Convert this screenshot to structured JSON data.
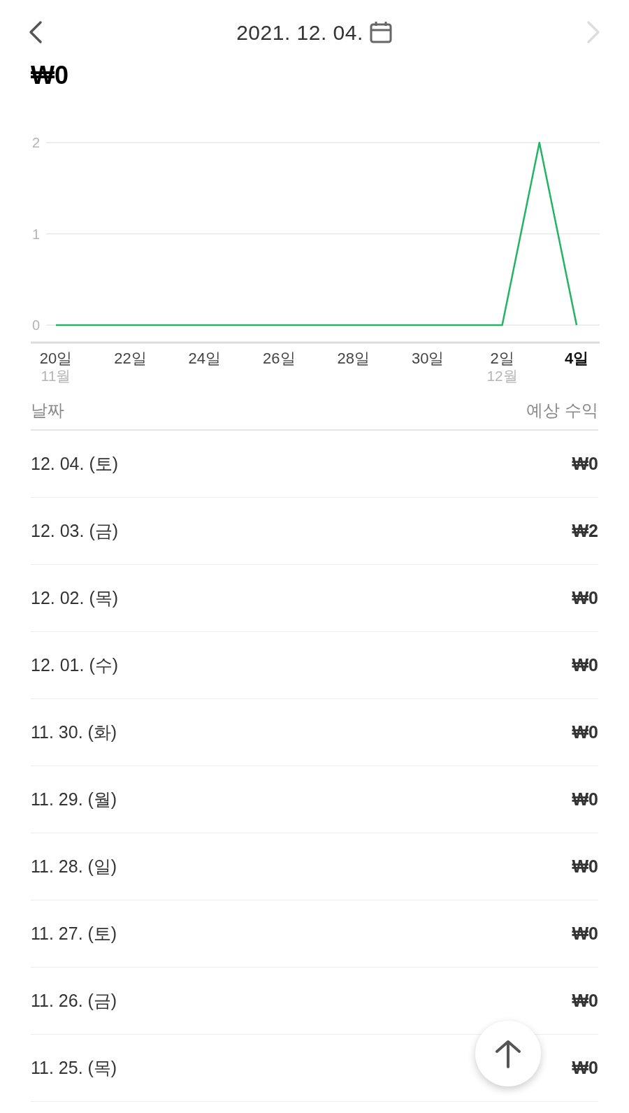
{
  "header": {
    "date": "2021. 12. 04.",
    "prev_enabled": true,
    "next_enabled": false
  },
  "total": "₩0",
  "chart_data": {
    "type": "line",
    "categories": [
      "20일",
      null,
      "22일",
      null,
      "24일",
      null,
      "26일",
      null,
      "28일",
      null,
      "30일",
      null,
      "2일",
      null,
      "4일"
    ],
    "series": [
      {
        "color": "#22b463",
        "values": [
          0,
          0,
          0,
          0,
          0,
          0,
          0,
          0,
          0,
          0,
          0,
          0,
          0,
          2,
          0
        ]
      }
    ],
    "ylim": [
      0,
      2
    ],
    "yticks": [
      0,
      1,
      2
    ]
  },
  "chart_x_labels": [
    {
      "month": "11월",
      "selected": false
    },
    {
      "selected": false
    },
    {
      "selected": false
    },
    {
      "selected": false
    },
    {
      "selected": false
    },
    {
      "selected": false
    },
    {
      "month": "12월",
      "selected": false
    },
    {
      "selected": true
    }
  ],
  "table": {
    "columns": [
      "날짜",
      "예상 수익"
    ],
    "rows": [
      {
        "date": "12. 04. (토)",
        "revenue": "₩0"
      },
      {
        "date": "12. 03. (금)",
        "revenue": "₩2"
      },
      {
        "date": "12. 02. (목)",
        "revenue": "₩0"
      },
      {
        "date": "12. 01. (수)",
        "revenue": "₩0"
      },
      {
        "date": "11. 30. (화)",
        "revenue": "₩0"
      },
      {
        "date": "11. 29. (월)",
        "revenue": "₩0"
      },
      {
        "date": "11. 28. (일)",
        "revenue": "₩0"
      },
      {
        "date": "11. 27. (토)",
        "revenue": "₩0"
      },
      {
        "date": "11. 26. (금)",
        "revenue": "₩0"
      },
      {
        "date": "11. 25. (목)",
        "revenue": "₩0"
      }
    ]
  },
  "scroll_top_button": {
    "shown": true
  }
}
